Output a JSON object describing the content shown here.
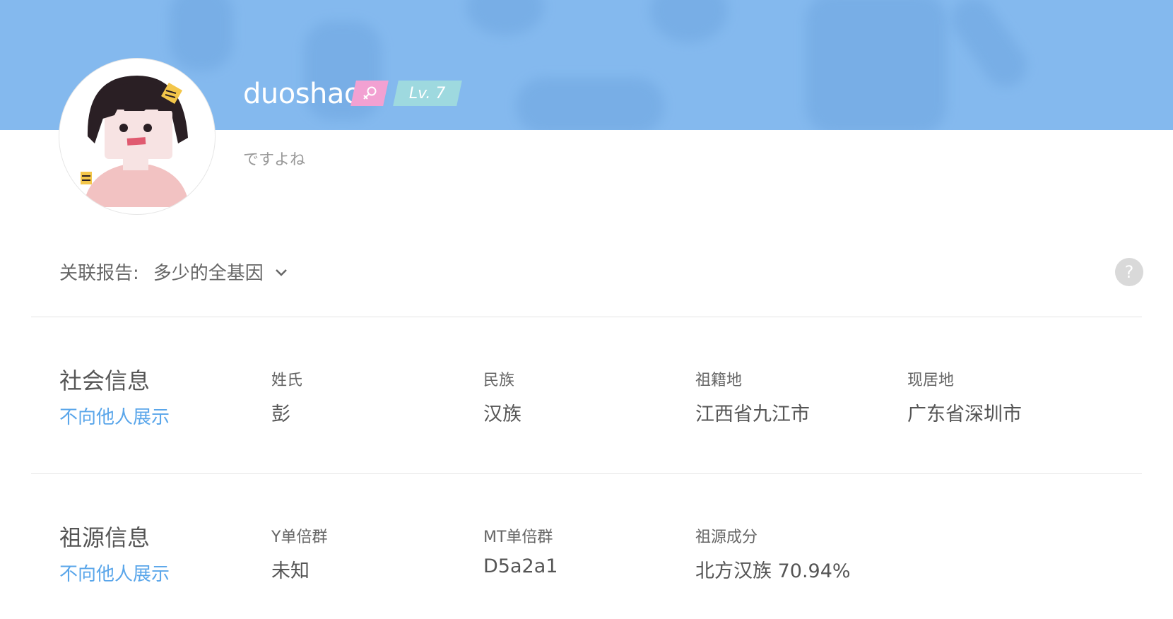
{
  "profile": {
    "username": "duoshao",
    "gender_icon": "female-icon",
    "level": "Lv. 7",
    "signature": "ですよね",
    "colors": {
      "banner": "#84b9ee",
      "gender_badge": "#f2a1d2",
      "level_badge": "#9ed9df"
    }
  },
  "report": {
    "label": "关联报告:",
    "selected": "多少的全基因",
    "help": "?"
  },
  "social": {
    "title": "社会信息",
    "visibility": "不向他人展示",
    "fields": [
      {
        "label": "姓氏",
        "value": "彭"
      },
      {
        "label": "民族",
        "value": "汉族"
      },
      {
        "label": "祖籍地",
        "value": "江西省九江市"
      },
      {
        "label": "现居地",
        "value": "广东省深圳市"
      }
    ]
  },
  "ancestry": {
    "title": "祖源信息",
    "visibility": "不向他人展示",
    "fields": [
      {
        "label": "Y单倍群",
        "value": "未知"
      },
      {
        "label": "MT单倍群",
        "value": "D5a2a1"
      },
      {
        "label": "祖源成分",
        "value": "北方汉族 70.94%"
      }
    ]
  },
  "link_color": "#5aa6ea"
}
